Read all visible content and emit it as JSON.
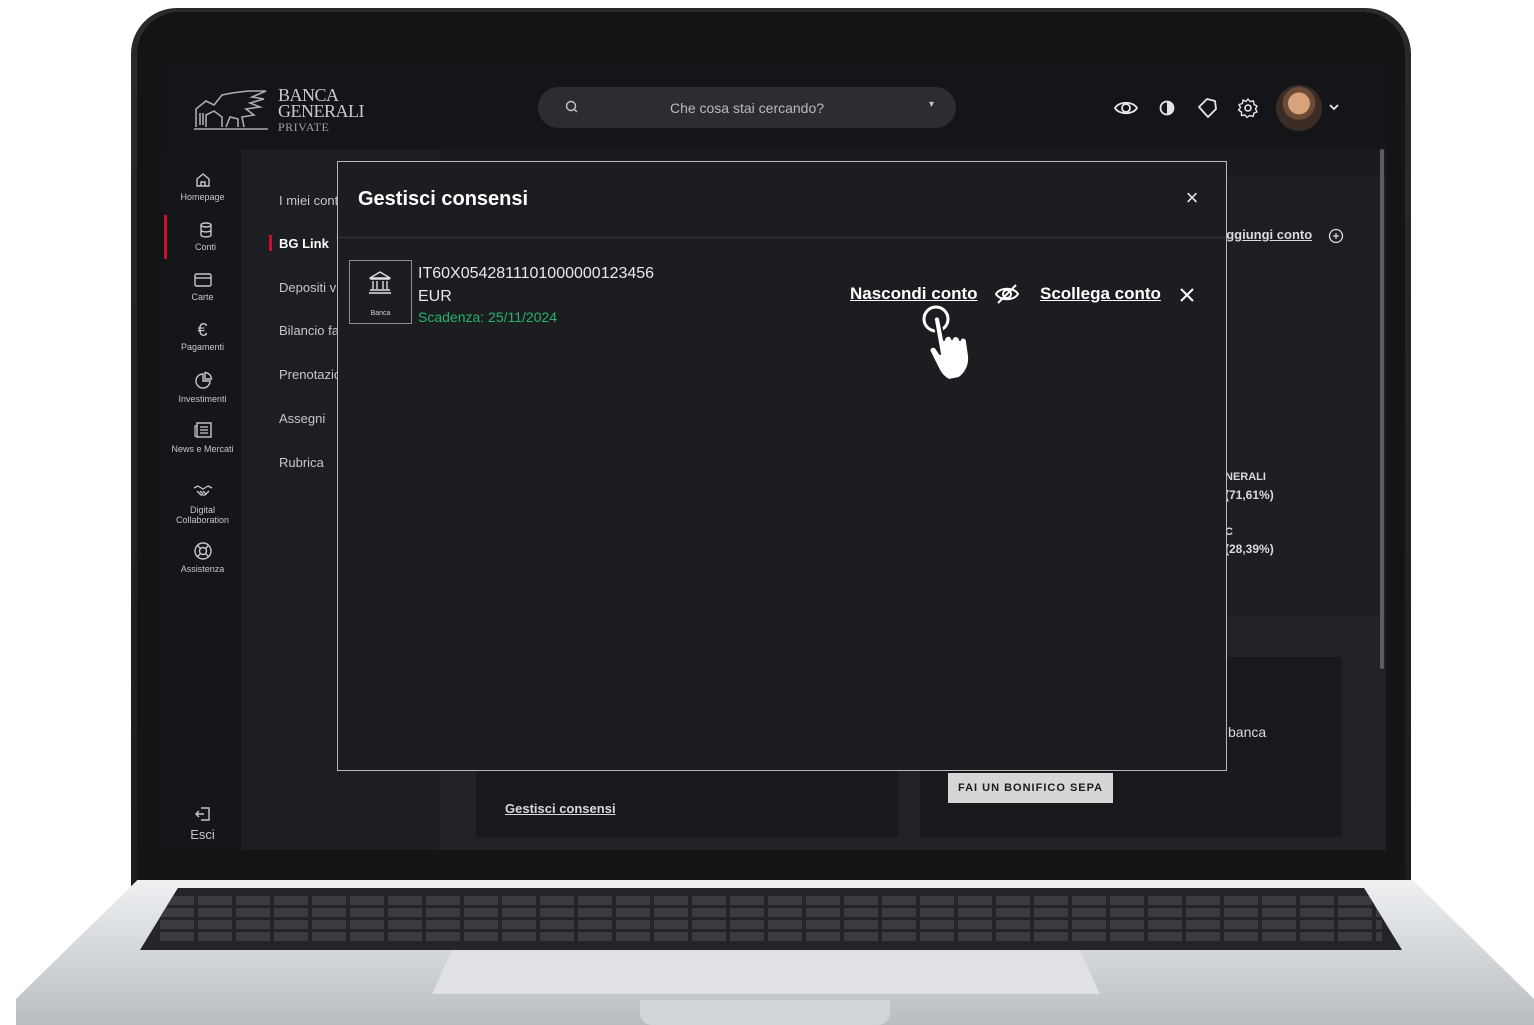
{
  "brand": {
    "line1": "BANCA",
    "line2": "GENERALI",
    "line3": "PRIVATE"
  },
  "search": {
    "placeholder": "Che cosa stai cercando?"
  },
  "toolbar_icons": [
    "eye-icon",
    "contrast-icon",
    "tag-icon",
    "gear-icon"
  ],
  "rail": {
    "items": [
      {
        "label": "Homepage",
        "icon": "home-icon"
      },
      {
        "label": "Conti",
        "icon": "database-icon",
        "active": true
      },
      {
        "label": "Carte",
        "icon": "card-icon"
      },
      {
        "label": "Pagamenti",
        "icon": "euro-icon"
      },
      {
        "label": "Investimenti",
        "icon": "pie-chart-icon"
      },
      {
        "label": "News e Mercati",
        "icon": "newspaper-icon"
      },
      {
        "label": "Digital Collaboration",
        "icon": "handshake-icon"
      },
      {
        "label": "Assistenza",
        "icon": "lifebuoy-icon"
      }
    ],
    "exit_label": "Esci"
  },
  "subnav": {
    "items": [
      {
        "label": "I miei conti"
      },
      {
        "label": "BG Link",
        "active": true
      },
      {
        "label": "Depositi vincolati"
      },
      {
        "label": "Bilancio familiare"
      },
      {
        "label": "Prenotazioni"
      },
      {
        "label": "Assegni"
      },
      {
        "label": "Rubrica"
      }
    ]
  },
  "background": {
    "add_account": "aggiungi conto",
    "legend1_name": "NERALI",
    "legend1_pct": "(71,61%)",
    "legend2_name": "C",
    "legend2_pct": "(28,39%)",
    "banca_text": "banca",
    "manage_consents_link": "Gestisci consensi",
    "sepa_button": "FAI UN BONIFICO SEPA"
  },
  "modal": {
    "title": "Gestisci consensi",
    "close_label": "×",
    "account": {
      "bank_label": "Banca",
      "iban": "IT60X0542811101000000123456",
      "currency": "EUR",
      "expiry": "Scadenza: 25/11/2024"
    },
    "hide_account": "Nascondi conto",
    "unlink_account": "Scollega conto"
  },
  "colors": {
    "accent_red": "#c8102e",
    "expiry_green": "#27b36b",
    "modal_bg": "#1b1d21"
  }
}
